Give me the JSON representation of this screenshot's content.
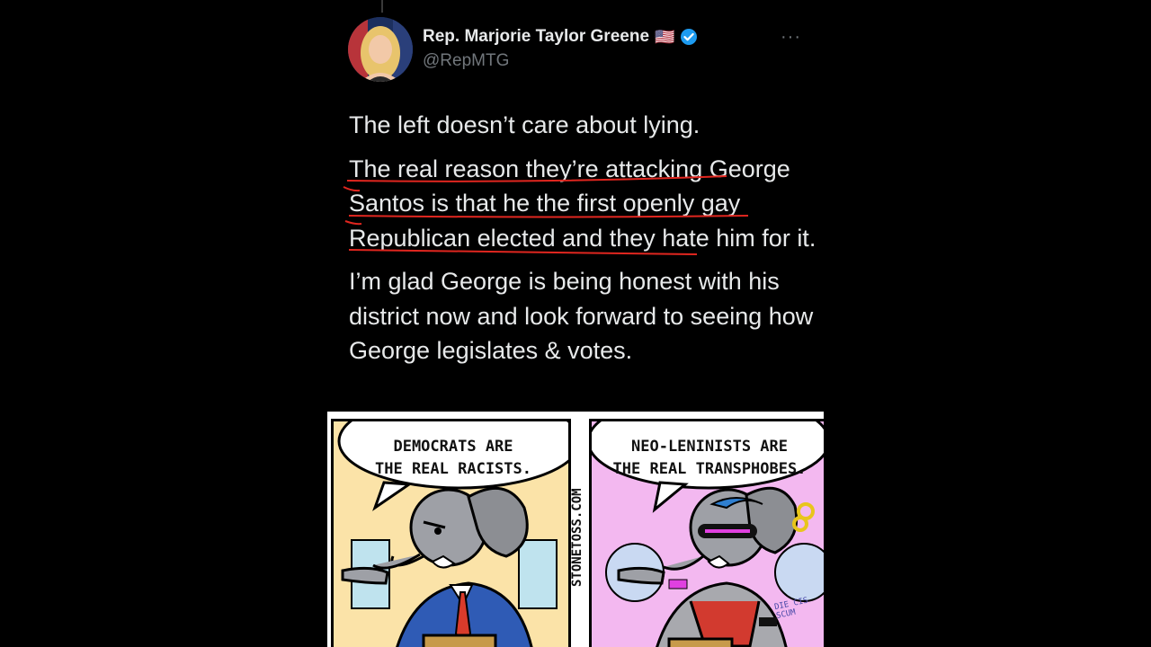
{
  "tweet": {
    "display_name": "Rep. Marjorie Taylor Greene",
    "flag_emoji": "🇺🇸",
    "handle": "@RepMTG",
    "more_label": "···",
    "verified_color": "#1d9bf0",
    "paragraphs": [
      "The left doesn’t care about lying.",
      "The real reason they’re attacking George Santos is that he the first openly gay Republican elected and they hate him for it.",
      "I’m glad George is being honest with his district now and look forward to seeing how George legislates & votes."
    ],
    "underline_color": "#e0261f"
  },
  "comic": {
    "left_bubble": "DEMOCRATS ARE\nTHE REAL RACISTS.",
    "right_bubble": "NEO-LENINISTS ARE\nTHE REAL TRANSPHOBES.",
    "credit": "STONETOSS.COM",
    "left_bg": "#fbe3a8",
    "right_bg": "#f3b8f0",
    "bracelet_text": "DIE CIS SCUM"
  }
}
